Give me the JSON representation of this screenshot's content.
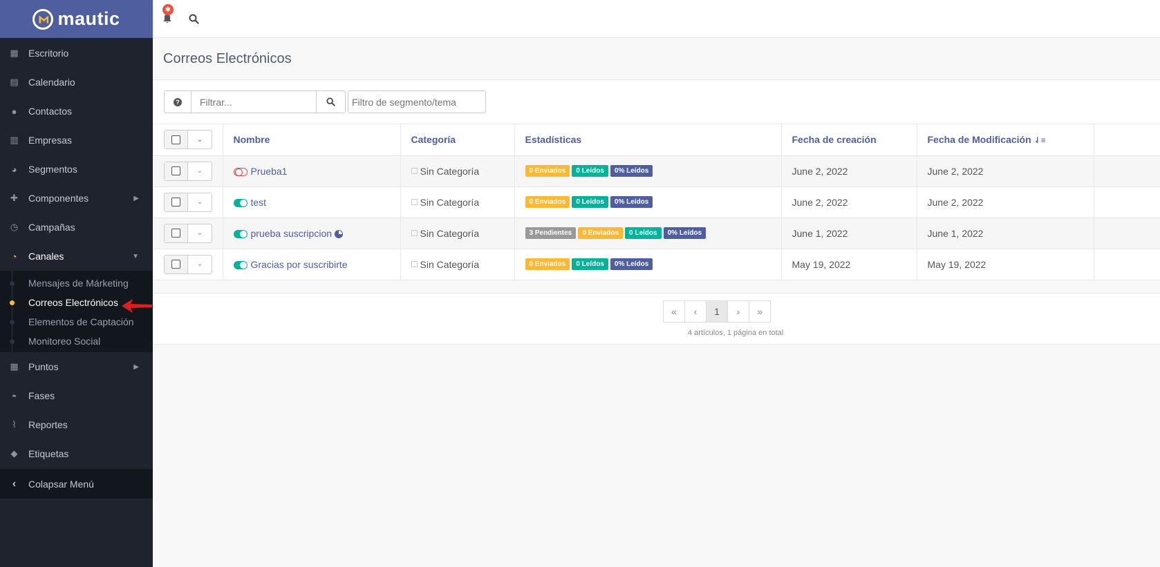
{
  "brand": {
    "name": "mautic"
  },
  "sidebar": {
    "items": [
      {
        "label": "Escritorio",
        "icon": "dashboard-icon"
      },
      {
        "label": "Calendario",
        "icon": "calendar-icon"
      },
      {
        "label": "Contactos",
        "icon": "user-icon"
      },
      {
        "label": "Empresas",
        "icon": "building-icon"
      },
      {
        "label": "Segmentos",
        "icon": "pie-chart-icon"
      },
      {
        "label": "Componentes",
        "icon": "puzzle-icon"
      },
      {
        "label": "Campañas",
        "icon": "clock-icon"
      },
      {
        "label": "Canales",
        "icon": "rss-icon"
      }
    ],
    "canales_sub": [
      {
        "label": "Mensajes de Márketing"
      },
      {
        "label": "Correos Electrónicos"
      },
      {
        "label": "Elementos de Captación"
      },
      {
        "label": "Monitoreo Social"
      }
    ],
    "items2": [
      {
        "label": "Puntos",
        "icon": "calculator-icon"
      },
      {
        "label": "Fases",
        "icon": "tachometer-icon"
      },
      {
        "label": "Reportes",
        "icon": "line-chart-icon"
      },
      {
        "label": "Etiquetas",
        "icon": "tag-icon"
      }
    ],
    "collapse_label": "Colapsar Menú"
  },
  "topbar": {
    "notification_count": "✱"
  },
  "page": {
    "title": "Correos Electrónicos"
  },
  "toolbar": {
    "filter_placeholder": "Filtrar...",
    "segment_placeholder": "Filtro de segmento/tema"
  },
  "table": {
    "headers": {
      "name": "Nombre",
      "category": "Categoría",
      "stats": "Estadísticas",
      "created": "Fecha de creación",
      "modified": "Fecha de Modificación"
    },
    "rows": [
      {
        "name": "Prueba1",
        "published": false,
        "category": "Sin Categoría",
        "stats": [
          {
            "label": "0 Enviados",
            "color": "#fdb933"
          },
          {
            "label": "0 Leídos",
            "color": "#00b49c"
          },
          {
            "label": "0% Leídos",
            "color": "#4e5e9e"
          }
        ],
        "created": "June 2, 2022",
        "modified": "June 2, 2022"
      },
      {
        "name": "test",
        "published": true,
        "category": "Sin Categoría",
        "stats": [
          {
            "label": "0 Enviados",
            "color": "#fdb933"
          },
          {
            "label": "0 Leídos",
            "color": "#00b49c"
          },
          {
            "label": "0% Leídos",
            "color": "#4e5e9e"
          }
        ],
        "created": "June 2, 2022",
        "modified": "June 2, 2022"
      },
      {
        "name": "prueba suscripcion",
        "published": true,
        "segment_icon": "pie-chart-icon",
        "category": "Sin Categoría",
        "stats": [
          {
            "label": "3 Pendientes",
            "color": "#999999"
          },
          {
            "label": "0 Enviados",
            "color": "#fdb933"
          },
          {
            "label": "0 Leídos",
            "color": "#00b49c"
          },
          {
            "label": "0% Leídos",
            "color": "#4e5e9e"
          }
        ],
        "created": "June 1, 2022",
        "modified": "June 1, 2022"
      },
      {
        "name": "Gracias por suscribirte",
        "published": true,
        "category": "Sin Categoría",
        "stats": [
          {
            "label": "0 Enviados",
            "color": "#fdb933"
          },
          {
            "label": "0 Leídos",
            "color": "#00b49c"
          },
          {
            "label": "0% Leídos",
            "color": "#4e5e9e"
          }
        ],
        "created": "May 19, 2022",
        "modified": "May 19, 2022"
      }
    ]
  },
  "pagination": {
    "first": "«",
    "prev": "‹",
    "current": "1",
    "next": "›",
    "last": "»",
    "info": "4 artículos, 1 página en total"
  }
}
